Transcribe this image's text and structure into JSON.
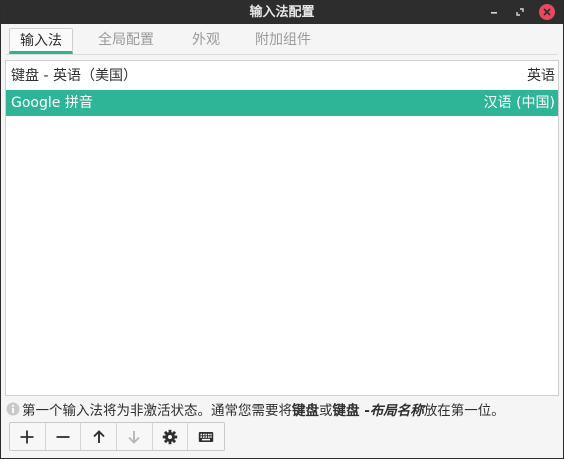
{
  "window": {
    "title": "输入法配置",
    "icons": [
      "minimize-icon",
      "maximize-icon",
      "close-icon"
    ],
    "close_color": "#e8495e"
  },
  "tabs": [
    {
      "label": "输入法",
      "active": true
    },
    {
      "label": "全局配置",
      "active": false
    },
    {
      "label": "外观",
      "active": false
    },
    {
      "label": "附加组件",
      "active": false
    }
  ],
  "input_methods": [
    {
      "name": "键盘 - 英语（美国）",
      "language": "英语",
      "selected": false
    },
    {
      "name": "Google 拼音",
      "language": "汉语 (中国)",
      "selected": true
    }
  ],
  "info": {
    "icon": "info-icon",
    "part1": "第一个输入法将为非激活状态。通常您需要将",
    "bold1": "键盘",
    "part2": "或",
    "bold2": "键盘 - ",
    "bold_italic": "布局名称",
    "part3": "放在第一位。"
  },
  "toolbar": {
    "buttons": [
      "add-icon",
      "remove-icon",
      "move-up-icon",
      "move-down-icon",
      "configure-icon",
      "keyboard-layout-icon"
    ],
    "disabled": [
      "move-down-icon"
    ]
  },
  "colors": {
    "accent": "#2eb597",
    "titlebar": "#2d2d2d"
  }
}
